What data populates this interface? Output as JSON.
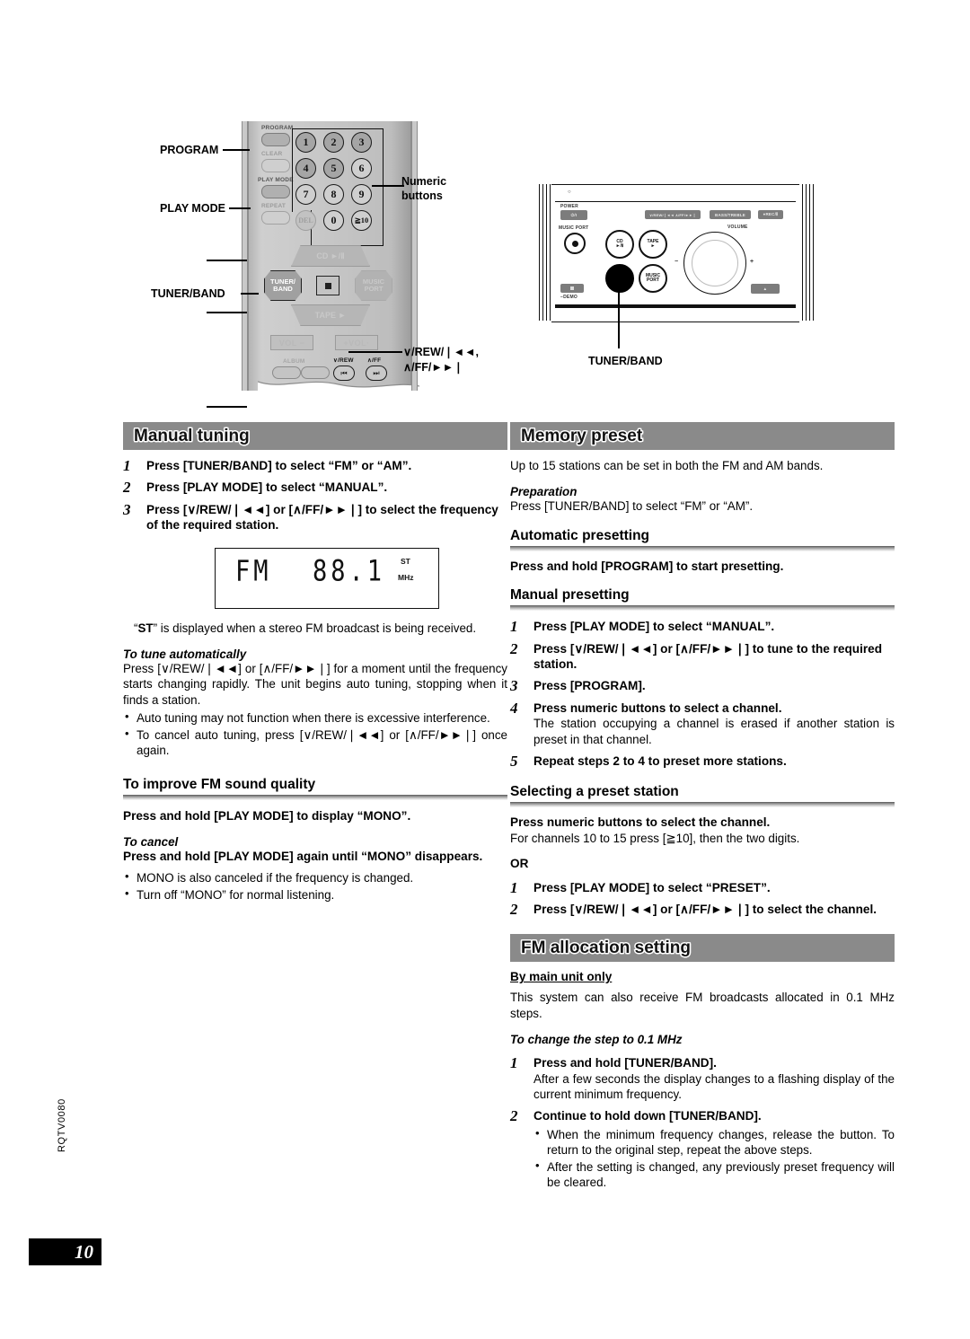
{
  "page": {
    "number": "10",
    "side_code": "RQTV0080"
  },
  "diagram": {
    "remote": {
      "labels": {
        "program": "PROGRAM",
        "play_mode": "PLAY MODE",
        "tuner_band": "TUNER/BAND",
        "numeric_buttons": "Numeric\nbuttons",
        "numeric_buttons_line1": "Numeric",
        "numeric_buttons_line2": "buttons",
        "skip_line1": "∨/REW/❘◄◄,",
        "skip_line2": "∧/FF/►►❘"
      },
      "small_labels": {
        "program": "PROGRAM",
        "clear": "CLEAR",
        "play_mode": "PLAY MODE",
        "repeat": "REPEAT",
        "album": "ALBUM",
        "rew": "∨/REW",
        "ff": "∧/FF"
      },
      "numeric_keys": [
        "1",
        "2",
        "3",
        "4",
        "5",
        "6",
        "7",
        "8",
        "9",
        "DEL",
        "0",
        "≧10"
      ],
      "transport": {
        "cd": "CD ►/Ⅱ",
        "tape": "TAPE ►",
        "tuner_band": "TUNER/\nBAND",
        "tuner_band_line1": "TUNER/",
        "tuner_band_line2": "BAND",
        "music_port_line1": "MUSIC",
        "music_port_line2": "PORT",
        "vol_minus": "VOL −",
        "vol_plus": "+VOL·"
      }
    },
    "main_unit": {
      "callout": "TUNER/BAND",
      "labels": {
        "power": "POWER",
        "power_icon": "⏻/I",
        "music_port": "MUSIC PORT",
        "demo": "−DEMO",
        "volume": "VOLUME",
        "skip_pill": "∨/REW/❘◄◄   ∧/FF/►►❘",
        "bass_treble": "BASS/TREBLE",
        "rec": "●REC/Ⅱ",
        "minus": "−",
        "plus": "+",
        "cd_line1": "CD",
        "cd_line2": "►/Ⅱ",
        "tape_line1": "TAPE",
        "tape_line2": "►",
        "mp_line1": "MUSIC",
        "mp_line2": "PORT",
        "eject": "▲"
      }
    }
  },
  "left_column": {
    "section_title": "Manual tuning",
    "steps": [
      {
        "n": "1",
        "text": "Press [TUNER/BAND] to select “FM” or “AM”."
      },
      {
        "n": "2",
        "text": "Press [PLAY MODE] to select “MANUAL”."
      },
      {
        "n": "3",
        "text": "Press [∨/REW/❘◄◄] or [∧/FF/►►❘] to select the frequency of the required station."
      }
    ],
    "lcd": {
      "band": "FM",
      "frequency": "88.1",
      "stereo_indicator": "ST",
      "unit": "MHz"
    },
    "st_note_pre": "“",
    "st_note_bold": "ST",
    "st_note_post": "” is displayed when a stereo FM broadcast is being received.",
    "auto_tune": {
      "heading": "To tune automatically",
      "body": "Press [∨/REW/❘◄◄] or [∧/FF/►►❘] for a moment until the frequency starts changing rapidly. The unit begins auto tuning, stopping when it finds a station.",
      "bullets": [
        "Auto tuning may not function when there is excessive interference.",
        "To cancel auto tuning, press [∨/REW/❘◄◄] or [∧/FF/►►❘] once again."
      ]
    },
    "fm_quality": {
      "heading": "To improve FM sound quality",
      "bold_line": "Press and hold [PLAY MODE] to display “MONO”.",
      "cancel_heading": "To cancel",
      "cancel_body": "Press and hold [PLAY MODE] again until “MONO” disappears.",
      "bullets": [
        "MONO is also canceled if the frequency is changed.",
        "Turn off “MONO” for normal listening."
      ]
    }
  },
  "right_column": {
    "section_title": "Memory preset",
    "intro": "Up to 15 stations can be set in both the FM and AM bands.",
    "preparation": {
      "heading": "Preparation",
      "body": "Press [TUNER/BAND] to select “FM” or “AM”."
    },
    "automatic_presetting": {
      "heading": "Automatic presetting",
      "bold_line": "Press and hold [PROGRAM] to start presetting."
    },
    "manual_presetting": {
      "heading": "Manual presetting",
      "steps": [
        {
          "n": "1",
          "bold": "Press [PLAY MODE] to select “MANUAL”.",
          "body": ""
        },
        {
          "n": "2",
          "bold": "Press [∨/REW/❘◄◄] or [∧/FF/►►❘] to tune to the required station.",
          "body": ""
        },
        {
          "n": "3",
          "bold": "Press [PROGRAM].",
          "body": ""
        },
        {
          "n": "4",
          "bold": "Press numeric buttons to select a channel.",
          "body": "The station occupying a channel is erased if another station is preset in that channel."
        },
        {
          "n": "5",
          "bold": "Repeat steps 2 to 4 to preset more stations.",
          "body": ""
        }
      ]
    },
    "selecting_preset": {
      "heading": "Selecting a preset station",
      "bold_line": "Press numeric buttons to select the channel.",
      "body": "For channels 10 to 15 press [≧10], then the two digits.",
      "or": "OR",
      "steps": [
        {
          "n": "1",
          "bold": "Press [PLAY MODE] to select “PRESET”."
        },
        {
          "n": "2",
          "bold": "Press [∨/REW/❘◄◄] or [∧/FF/►►❘] to select the channel."
        }
      ]
    },
    "fm_allocation": {
      "section_title": "FM allocation setting",
      "sub_heading": "By main unit only",
      "body": "This system can also receive FM broadcasts allocated in 0.1 MHz steps.",
      "change_heading": "To change the step to 0.1 MHz",
      "steps": [
        {
          "n": "1",
          "bold": "Press and hold [TUNER/BAND].",
          "body": "After a few seconds the display changes to a flashing display of the current minimum frequency.",
          "bullets": []
        },
        {
          "n": "2",
          "bold": "Continue to hold down [TUNER/BAND].",
          "body": "",
          "bullets": [
            "When the minimum frequency changes, release the button. To return to the original step, repeat the above steps.",
            "After the setting is changed, any previously preset frequency will be cleared."
          ]
        }
      ]
    }
  }
}
